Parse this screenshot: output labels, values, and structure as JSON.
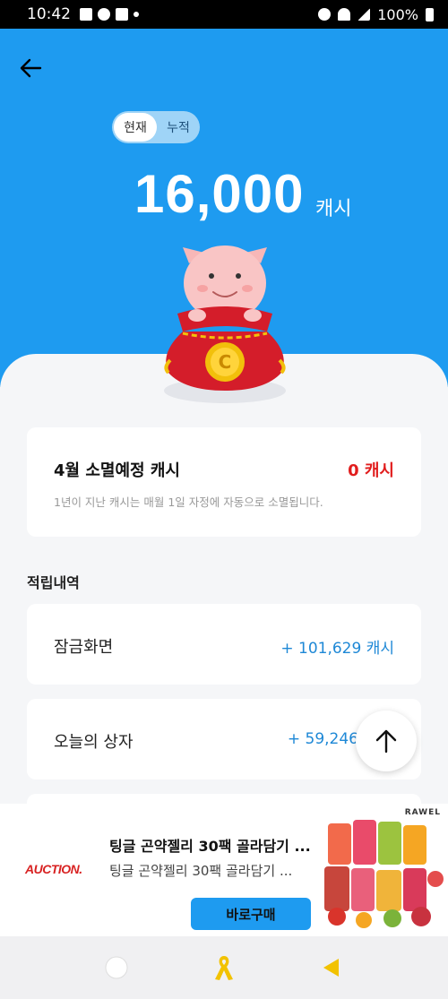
{
  "status_bar": {
    "time": "10:42",
    "battery": "100%"
  },
  "header": {
    "tab_current": "현재",
    "tab_cumulative": "누적",
    "amount": "16,000",
    "unit": "캐시"
  },
  "expire_card": {
    "title": "4월 소멸예정 캐시",
    "value": "0 캐시",
    "description": "1년이 지난 캐시는 매월 1일 자정에 자동으로 소멸됩니다."
  },
  "history": {
    "title": "적립내역",
    "items": [
      {
        "label": "잠금화면",
        "value": "+ 101,629 캐시"
      },
      {
        "label": "오늘의 상자",
        "value": "+ 59,246"
      }
    ]
  },
  "ad": {
    "brand": "AUCTION.",
    "title": "팅글 곤약젤리 30팩 골라담기 ...",
    "subtitle": "팅글 곤약젤리 30팩 골라담기 ...",
    "button": "바로구매",
    "product_brand": "RAWEL"
  },
  "colors": {
    "primary": "#1e9bf0",
    "negative": "#e11d1d",
    "positive": "#1e88d6"
  }
}
